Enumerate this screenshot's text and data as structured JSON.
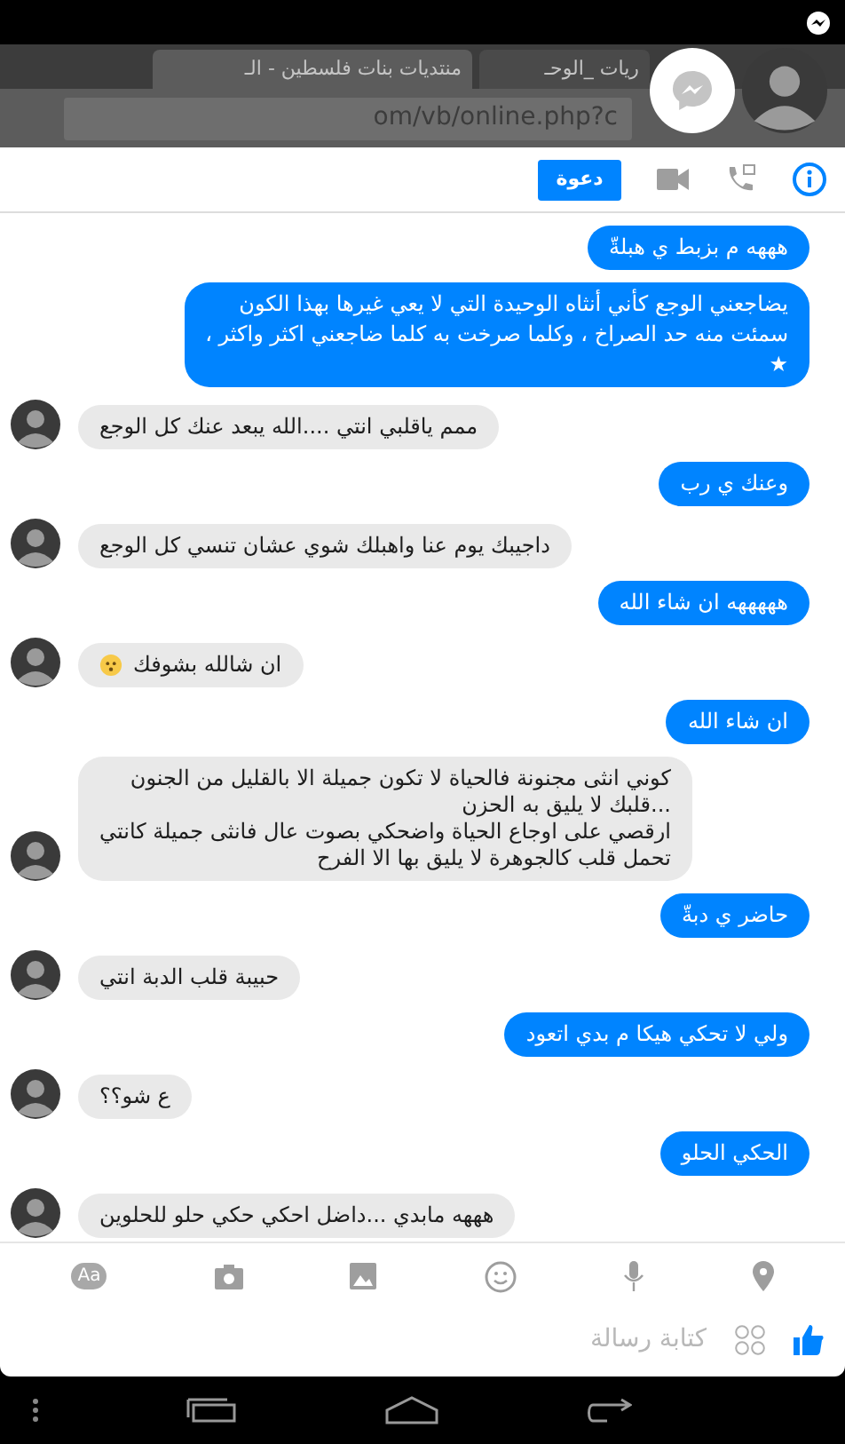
{
  "browser": {
    "tabs": [
      {
        "title": "ريات _الوحـ",
        "selected": false
      },
      {
        "title": "منتديات بنات فلسطين - الـ",
        "selected": true
      }
    ],
    "url": "om/vb/online.php?c"
  },
  "header": {
    "invite_button": "دعوة"
  },
  "messages": [
    {
      "kind": "sent",
      "text": "هههه م بزبط ي هبلةّ"
    },
    {
      "kind": "sent",
      "text": "يضاجعني الوجع كأني أنثاه الوحيدة التي لا يعي غيرها بهذا الكون\nسمئت منه حد الصراخ ، وكلما صرخت به كلما ضاجعني اكثر واكثر ،\n★"
    },
    {
      "kind": "received",
      "text": "ممم ياقلبي انتي ....الله يبعد عنك كل الوجع"
    },
    {
      "kind": "sent",
      "text": "وعنك ي رب"
    },
    {
      "kind": "received",
      "text": "داجيبك يوم عنا واهبلك شوي عشان تنسي كل الوجع"
    },
    {
      "kind": "sent",
      "text": "هههههه ان شاء الله"
    },
    {
      "kind": "received",
      "text": "ان شالله بشوفك",
      "emoji": true
    },
    {
      "kind": "sent",
      "text": "ان شاء الله"
    },
    {
      "kind": "received",
      "text": "كوني انثى مجنونة فالحياة لا تكون جميلة الا بالقليل من الجنون\n...قلبك لا يليق به الحزن\nارقصي على اوجاع الحياة واضحكي بصوت عال فانثى جميلة كانتي\nتحمل قلب كالجوهرة لا يليق بها الا الفرح"
    },
    {
      "kind": "sent",
      "text": "حاضر ي دبةّ"
    },
    {
      "kind": "received",
      "text": "حبيبة قلب الدبة انتي"
    },
    {
      "kind": "sent",
      "text": "ولي لا تحكي هيكا م بدي اتعود"
    },
    {
      "kind": "received",
      "text": "ع شو؟؟"
    },
    {
      "kind": "sent",
      "text": "الحكي الحلو"
    },
    {
      "kind": "received",
      "text": "هههه مابدي ...داضل احكي حكي حلو للحلوين"
    }
  ],
  "composer": {
    "text_button": "Aa",
    "placeholder": "كتابة رسالة"
  }
}
